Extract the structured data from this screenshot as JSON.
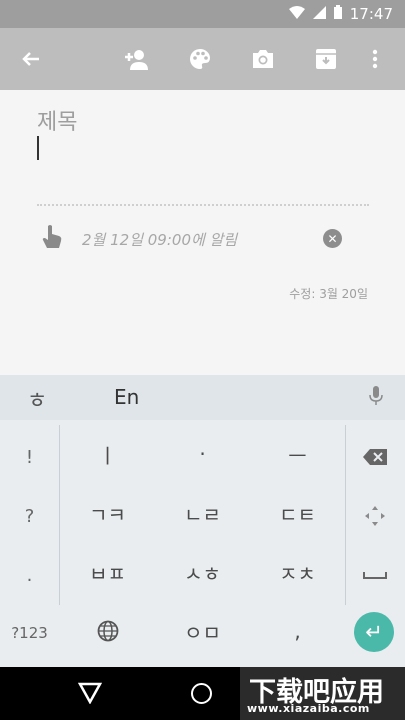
{
  "status_bar": {
    "time": "17:47"
  },
  "toolbar": {
    "icons": [
      "back-arrow-icon",
      "add-person-icon",
      "palette-icon",
      "camera-icon",
      "archive-icon",
      "more-vert-icon"
    ]
  },
  "note": {
    "title_placeholder": "제목",
    "reminder_text": "2월 12일 09:00에 알림",
    "edited_label": "수정: 3월 20일"
  },
  "keyboard": {
    "lang_button": "ㅎ",
    "mode_label": "En",
    "left_keys": [
      "!",
      "?",
      "."
    ],
    "right_keys": [
      "⌫",
      "✥",
      "␣"
    ],
    "main_rows": [
      [
        "ㅣ",
        "·",
        "ㅡ"
      ],
      [
        "ㄱㅋ",
        "ㄴㄹ",
        "ㄷㅌ"
      ],
      [
        "ㅂㅍ",
        "ㅅㅎ",
        "ㅈㅊ"
      ]
    ],
    "bottom_row": {
      "sym_label": "?123",
      "globe": "🌐",
      "zero_key": "ㅇㅁ",
      "comma_key": ",",
      "enter": "↵"
    }
  },
  "watermark": {
    "main": "下载吧应用",
    "sub": "www.xiazaiba.com"
  },
  "colors": {
    "accent": "#4bb9aa",
    "toolbar": "#bdbdbd",
    "status_bar": "#9e9e9e"
  }
}
